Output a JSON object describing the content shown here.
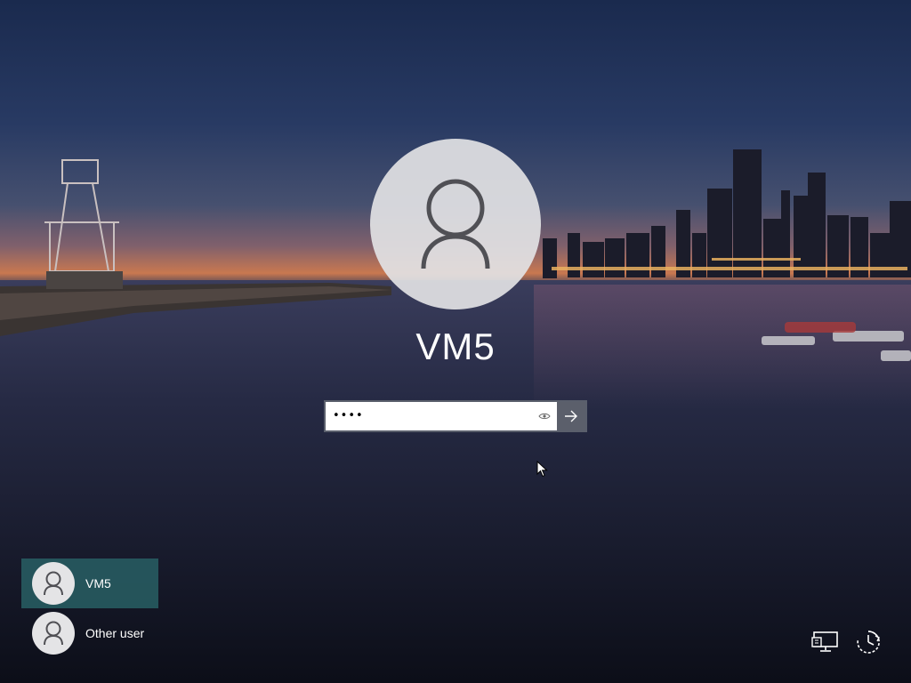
{
  "user": {
    "name": "VM5"
  },
  "password": {
    "value": "••••"
  },
  "icons": {
    "avatar": "user-silhouette-icon",
    "reveal": "eye-icon",
    "submit": "arrow-right-icon",
    "network": "network-icon",
    "ease_of_access": "ease-of-access-icon"
  },
  "user_list": [
    {
      "label": "VM5",
      "selected": true
    },
    {
      "label": "Other user",
      "selected": false
    }
  ],
  "colors": {
    "selected_tile": "#285f64",
    "submit_bg": "#5b5f6b"
  }
}
